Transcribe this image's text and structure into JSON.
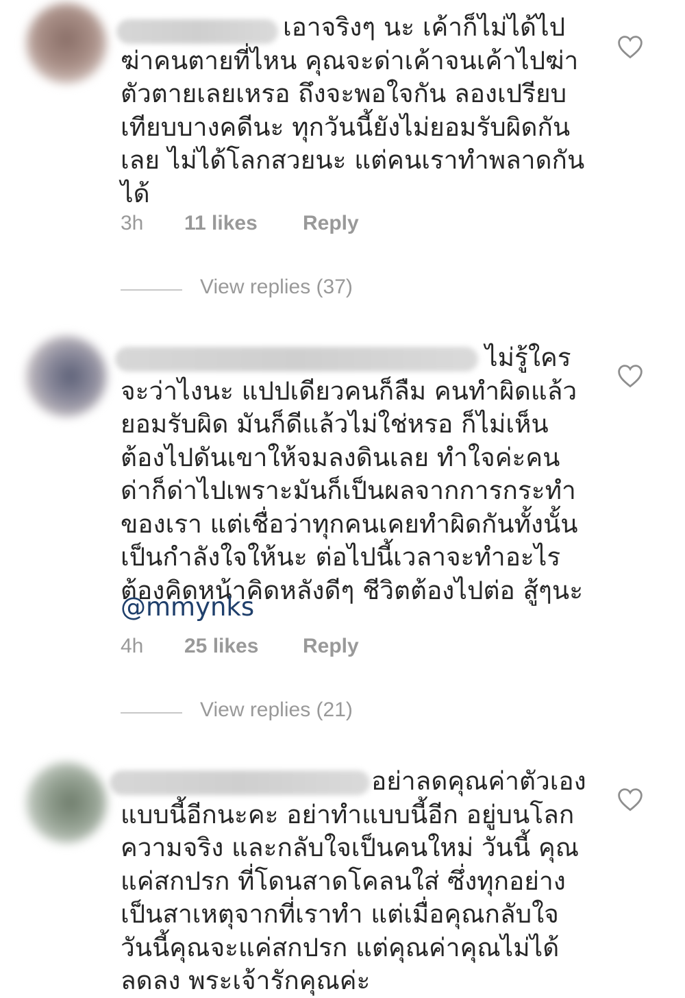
{
  "comments": [
    {
      "text": "เอาจริงๆ นะ เค้าก็ไม่ได้ไป\nฆ่าคนตายที่ไหน คุณจะด่าเค้าจนเค้าไปฆ่า\nตัวตายเลยเหรอ ถึงจะพอใจกัน ลองเปรียบ\nเทียบบางคดีนะ ทุกวันนี้ยังไม่ยอมรับผิดกัน\nเลย ไม่ได้โลกสวยนะ แต่คนเราทำพลาดกัน\nได้",
      "time": "3h",
      "likes": "11 likes",
      "reply": "Reply",
      "view_replies": "View replies (37)"
    },
    {
      "text": "ไม่รู้ใคร\nจะว่าไงนะ แปปเดียวคนก็ลืม คนทำผิดแล้ว\nยอมรับผิด มันก็ดีแล้วไม่ใช่หรอ ก็ไม่เห็น\nต้องไปดันเขาให้จมลงดินเลย ทำใจค่ะคน\nด่าก็ด่าไปเพราะมันก็เป็นผลจากการกระทำ\nของเรา แต่เชื่อว่าทุกคนเคยทำผิดกันทั้งนั้น\nเป็นกำลังใจให้นะ ต่อไปนี้เวลาจะทำอะไร\nต้องคิดหน้าคิดหลังดีๆ ชีวิตต้องไปต่อ สู้ๆนะ",
      "mention": "@mmynks",
      "time": "4h",
      "likes": "25 likes",
      "reply": "Reply",
      "view_replies": "View replies (21)"
    },
    {
      "text": "อย่าลดคุณค่าตัวเอง\nแบบนี้อีกนะคะ อย่าทำแบบนี้อีก อยู่บนโลก\nความจริง และกลับใจเป็นคนใหม่  วันนี้ คุณ\nแค่สกปรก ที่โดนสาดโคลนใส่ ซึ่งทุกอย่าง\nเป็นสาเหตุจากที่เราทำ  แต่เมื่อคุณกลับใจ\nวันนี้คุณจะแค่สกปรก แต่คุณค่าคุณไม่ได้\nลดลง พระเจ้ารักคุณค่ะ"
    }
  ]
}
